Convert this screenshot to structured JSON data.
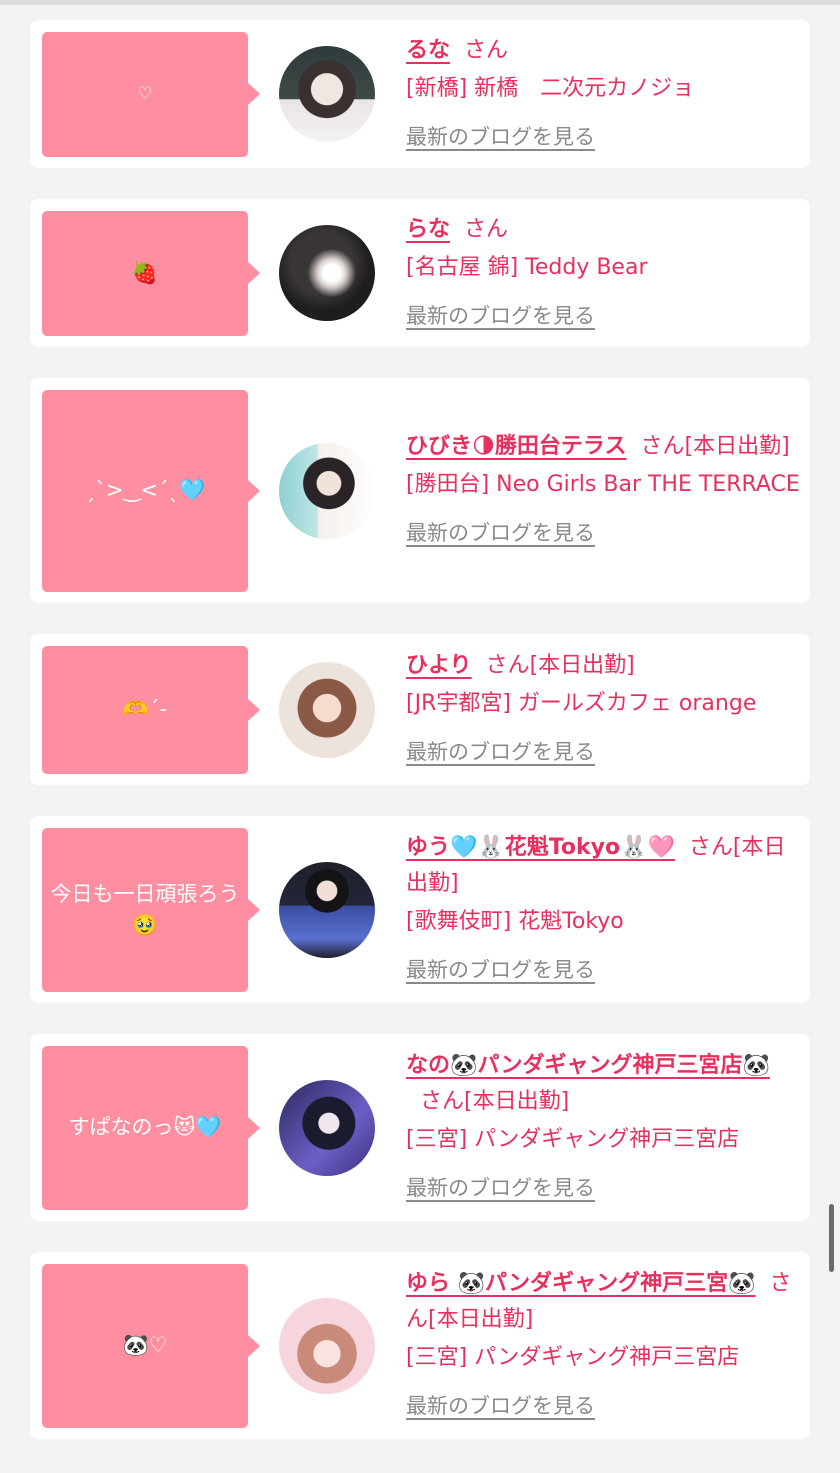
{
  "list": {
    "items": [
      {
        "bubble_text": "♡",
        "name": "るな",
        "suffix": "さん",
        "shop": "[新橋] 新橋　二次元カノジョ",
        "blog_link": "最新のブログを見る",
        "avatar_colors": [
          "#2f3b3a",
          "#dcdcdc"
        ]
      },
      {
        "bubble_text": "🍓",
        "name": "らな",
        "suffix": "さん",
        "shop": "[名古屋 錦] Teddy Bear",
        "blog_link": "最新のブログを見る",
        "avatar_colors": [
          "#2b2b2e",
          "#b9a9a6"
        ]
      },
      {
        "bubble_text": "ˏˋ>‿<ˊˎ🩵",
        "name": "ひびき🌗勝田台テラス",
        "suffix": "さん[本日出勤]",
        "shop": "[勝田台] Neo Girls Bar THE TERRACE",
        "blog_link": "最新のブログを見る",
        "avatar_colors": [
          "#9fd8d8",
          "#f2ece6"
        ]
      },
      {
        "bubble_text": "🫶ˊ-",
        "name": "ひより",
        "suffix": "さん[本日出勤]",
        "shop": "[JR宇都宮] ガールズカフェ orange",
        "blog_link": "最新のブログを見る",
        "avatar_colors": [
          "#e8ddd4",
          "#8a5a46"
        ]
      },
      {
        "bubble_text": "今日も一日頑張ろう🥹",
        "name": "ゆう🩵🐰花魁Tokyo🐰🩷",
        "suffix": "さん[本日出勤]",
        "shop": "[歌舞伎町] 花魁Tokyo",
        "blog_link": "最新のブログを見る",
        "avatar_colors": [
          "#1d1f2b",
          "#3b4fa0"
        ]
      },
      {
        "bubble_text": "すぱなのっ😻🩵",
        "name": "なの🐼パンダギャング神戸三宮店🐼",
        "suffix": "さん[本日出勤]",
        "shop": "[三宮] パンダギャング神戸三宮店",
        "blog_link": "最新のブログを見る",
        "avatar_colors": [
          "#2a2a5c",
          "#6b5fc7"
        ]
      },
      {
        "bubble_text": "🐼♡",
        "name": "ゆら 🐼パンダギャング神戸三宮🐼",
        "suffix": "さん[本日出勤]",
        "shop": "[三宮] パンダギャング神戸三宮店",
        "blog_link": "最新のブログを見る",
        "avatar_colors": [
          "#f6d6dc",
          "#c98a7a"
        ]
      }
    ]
  },
  "colors": {
    "accent": "#e8305e",
    "bubble": "#ff8fa0",
    "link_gray": "#8a8a8a",
    "page_bg": "#f3f3f3"
  }
}
